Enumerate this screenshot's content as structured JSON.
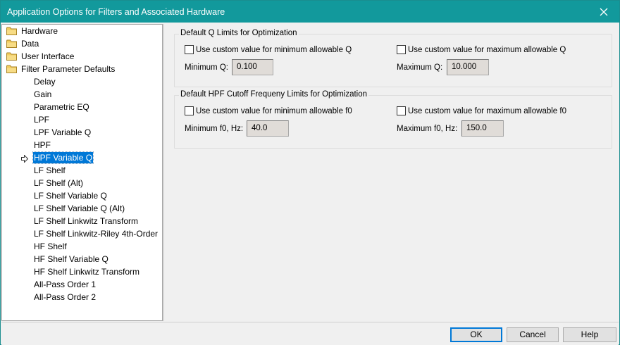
{
  "window": {
    "title": "Application Options for Filters and Associated Hardware",
    "close_icon": "close-icon"
  },
  "tree": {
    "folders": [
      {
        "label": "Hardware"
      },
      {
        "label": "Data"
      },
      {
        "label": "User Interface"
      },
      {
        "label": "Filter Parameter Defaults"
      }
    ],
    "children": [
      {
        "label": "Delay"
      },
      {
        "label": "Gain"
      },
      {
        "label": "Parametric EQ"
      },
      {
        "label": "LPF"
      },
      {
        "label": "LPF Variable Q"
      },
      {
        "label": "HPF"
      },
      {
        "label": "HPF Variable Q",
        "selected": true
      },
      {
        "label": "LF Shelf"
      },
      {
        "label": "LF Shelf (Alt)"
      },
      {
        "label": "LF Shelf Variable Q"
      },
      {
        "label": "LF Shelf Variable Q (Alt)"
      },
      {
        "label": "LF Shelf Linkwitz Transform"
      },
      {
        "label": "LF Shelf Linkwitz-Riley 4th-Order"
      },
      {
        "label": "HF Shelf"
      },
      {
        "label": "HF Shelf Variable Q"
      },
      {
        "label": "HF Shelf Linkwitz Transform"
      },
      {
        "label": "All-Pass Order 1"
      },
      {
        "label": "All-Pass Order 2"
      }
    ]
  },
  "q_limits": {
    "title": "Default Q Limits for Optimization",
    "min_check_label": "Use custom value for minimum allowable Q",
    "max_check_label": "Use custom value for maximum allowable Q",
    "min_label": "Minimum Q:",
    "min_value": "0.100",
    "max_label": "Maximum Q:",
    "max_value": "10.000"
  },
  "hpf_limits": {
    "title": "Default HPF Cutoff Frequeny Limits for Optimization",
    "min_check_label": "Use custom value for minimum allowable f0",
    "max_check_label": "Use custom value for maximum allowable f0",
    "min_label": "Minimum f0, Hz:",
    "min_value": "40.0",
    "max_label": "Maximum f0, Hz:",
    "max_value": "150.0"
  },
  "buttons": {
    "ok": "OK",
    "cancel": "Cancel",
    "help": "Help"
  }
}
